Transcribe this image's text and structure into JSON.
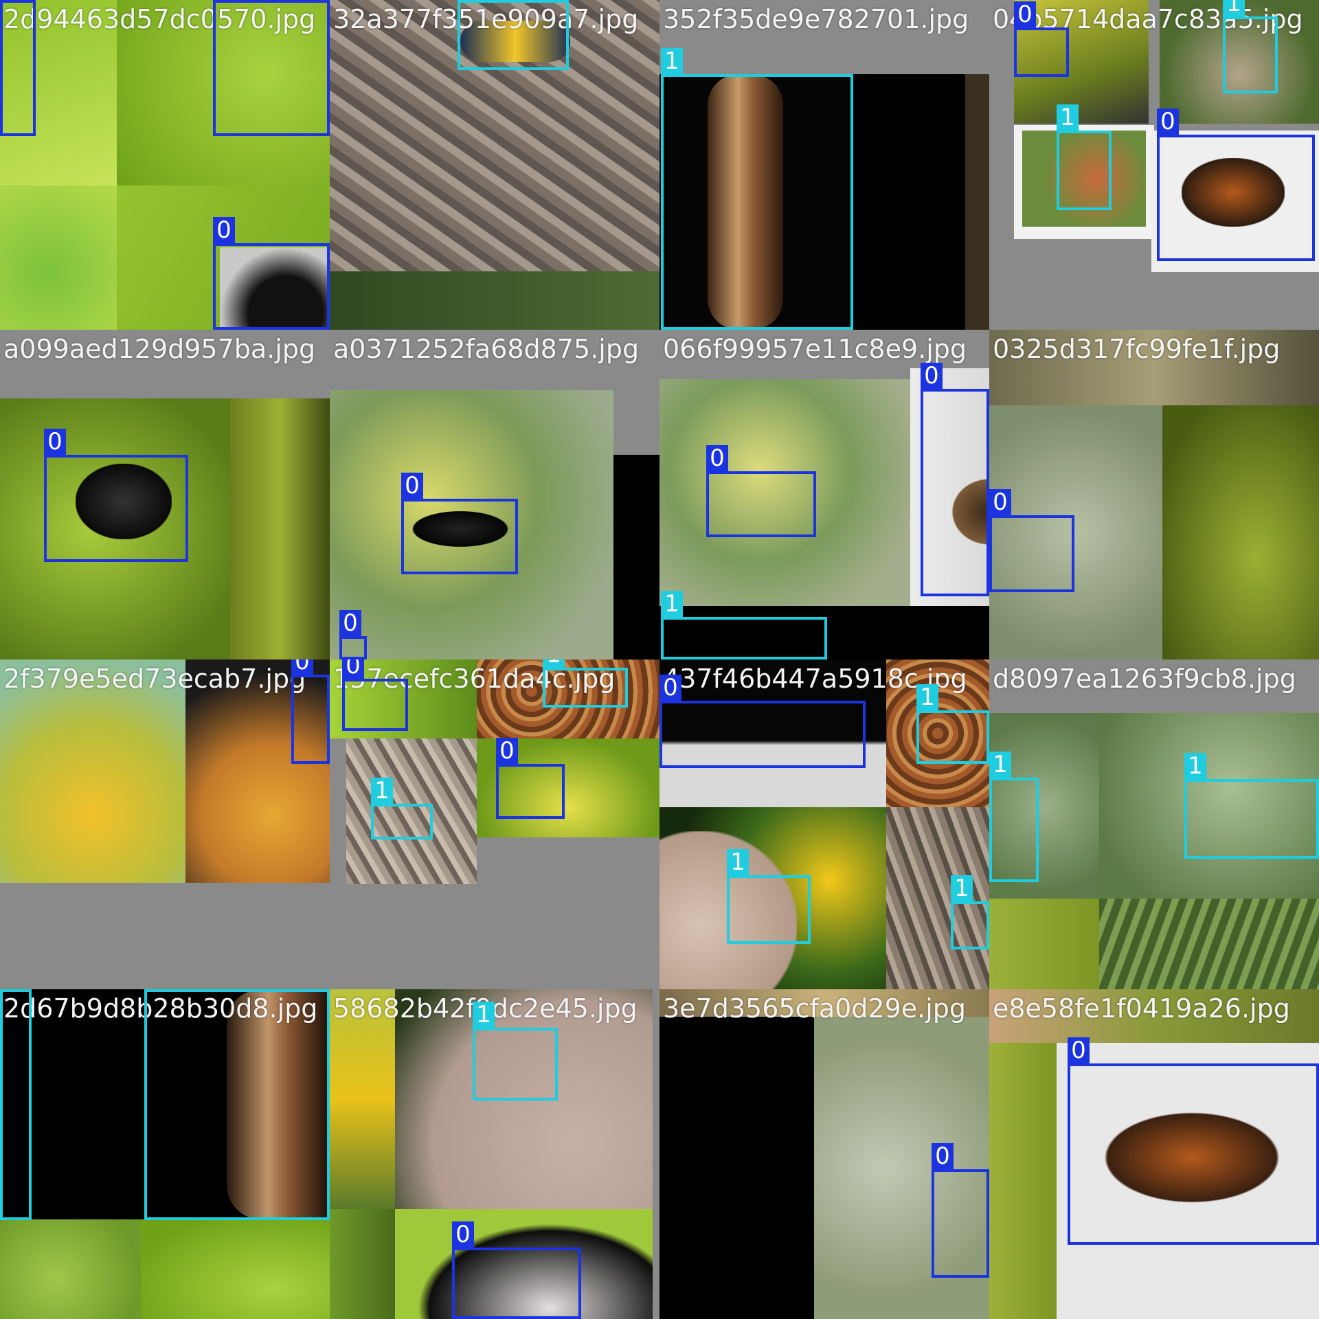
{
  "tiles": [
    {
      "filename": "2d94463d57dc0570.jpg"
    },
    {
      "filename": "32a377f351e909a7.jpg"
    },
    {
      "filename": "352f35de9e782701.jpg"
    },
    {
      "filename": "04b5714daa7c83a5.jpg"
    },
    {
      "filename": "a099aed129d957ba.jpg"
    },
    {
      "filename": "a0371252fa68d875.jpg"
    },
    {
      "filename": "066f99957e11c8e9.jpg"
    },
    {
      "filename": "0325d317fc99fe1f.jpg"
    },
    {
      "filename": "2f379e5ed73ecab7.jpg"
    },
    {
      "filename": "157ecefc361da4c.jpg"
    },
    {
      "filename": "437f46b447a5918c.jpg"
    },
    {
      "filename": "d8097ea1263f9cb8.jpg"
    },
    {
      "filename": "2d67b9d8b28b30d8.jpg"
    },
    {
      "filename": "58682b42f9dc2e45.jpg"
    },
    {
      "filename": "3e7d3565cfa0d29e.jpg"
    },
    {
      "filename": "e8e58fe1f0419a26.jpg"
    }
  ],
  "class_labels": [
    "0",
    "1"
  ],
  "colors": {
    "class_0": "#1c33e0",
    "class_1": "#20ccdf",
    "padding": "#8a8a8a"
  }
}
